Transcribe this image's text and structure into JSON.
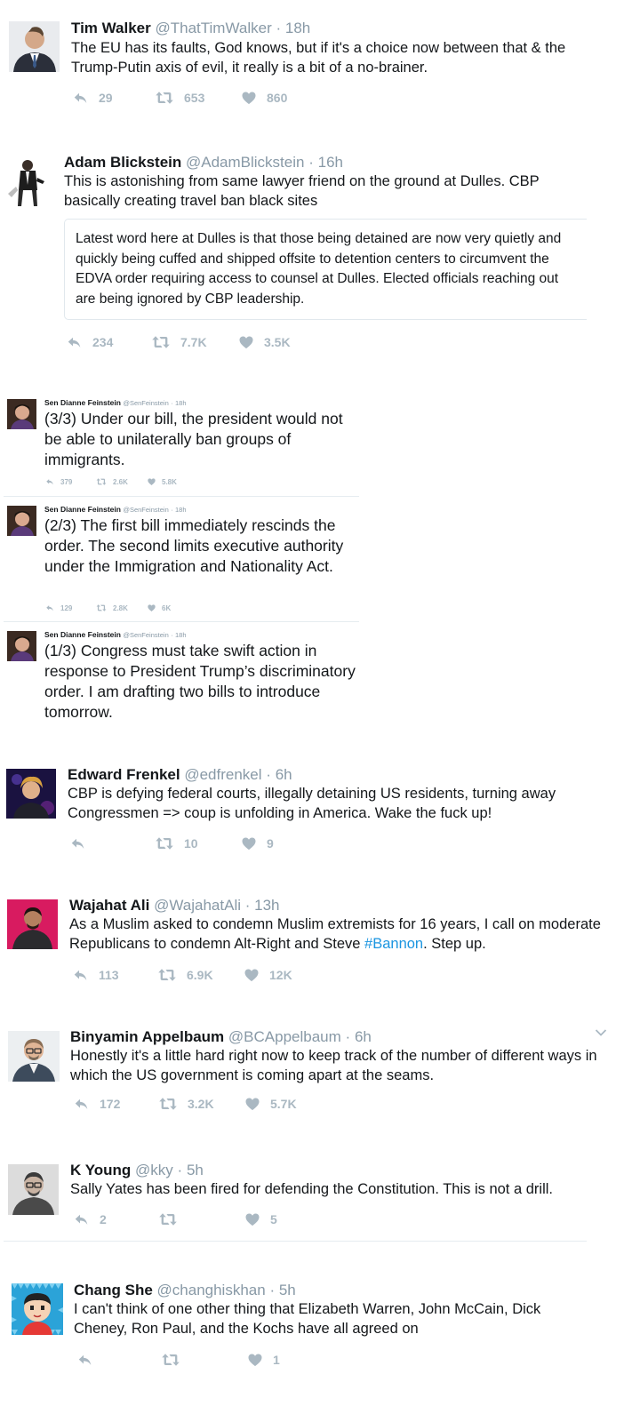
{
  "tweets": [
    {
      "name": "Tim Walker",
      "handle": "@ThatTimWalker",
      "time": "18h",
      "text": "The EU has its faults, God knows, but if it's a choice now between that & the Trump-Putin axis of evil, it really is a bit of a no-brainer.",
      "replies": "29",
      "retweets": "653",
      "likes": "860"
    },
    {
      "name": "Adam Blickstein",
      "handle": "@AdamBlickstein",
      "time": "16h",
      "text": "This is astonishing from same lawyer friend on the ground at Dulles. CBP basically creating travel ban black sites",
      "quote": "Latest word here at Dulles is that those being detained are now very quietly and quickly being cuffed and shipped offsite to detention centers to circumvent the EDVA order requiring access to counsel at Dulles. Elected officials reaching out are being ignored by CBP leadership.",
      "replies": "234",
      "retweets": "7.7K",
      "likes": "3.5K"
    },
    {
      "name": "Sen Dianne Feinstein",
      "handle": "@SenFeinstein",
      "time": "18h",
      "text": "(3/3) Under our bill, the president would not be able to unilaterally ban groups of immigrants.",
      "replies": "379",
      "retweets": "2.6K",
      "likes": "5.8K"
    },
    {
      "name": "Sen Dianne Feinstein",
      "handle": "@SenFeinstein",
      "time": "18h",
      "text": "(2/3) The first bill immediately rescinds the order. The second limits executive authority under the Immigration and Nationality Act.",
      "replies": "129",
      "retweets": "2.8K",
      "likes": "6K"
    },
    {
      "name": "Sen Dianne Feinstein",
      "handle": "@SenFeinstein",
      "time": "18h",
      "text": "(1/3) Congress must take swift action in response to President Trump’s discriminatory order. I am drafting two bills to introduce tomorrow."
    },
    {
      "name": "Edward Frenkel",
      "handle": "@edfrenkel",
      "time": "6h",
      "text": "CBP is defying federal courts, illegally detaining US residents, turning away Congressmen => coup is unfolding in America. Wake the fuck up!",
      "retweets": "10",
      "likes": "9"
    },
    {
      "name": "Wajahat Ali",
      "handle": "@WajahatAli",
      "time": "13h",
      "text_before": "As a Muslim asked to condemn Muslim extremists for 16 years, I call on moderate Republicans to condemn Alt-Right and Steve ",
      "hashtag": "#Bannon",
      "text_after": ". Step up.",
      "replies": "113",
      "retweets": "6.9K",
      "likes": "12K"
    },
    {
      "name": "Binyamin Appelbaum",
      "handle": "@BCAppelbaum",
      "time": "6h",
      "text": "Honestly it's a little hard right now to keep track of the number of different ways in which the US government is coming apart at the seams.",
      "replies": "172",
      "retweets": "3.2K",
      "likes": "5.7K"
    },
    {
      "name": "K Young",
      "handle": "@kky",
      "time": "5h",
      "text": "Sally Yates has been fired for defending the Constitution. This is not a drill.",
      "replies": "2",
      "likes": "5"
    },
    {
      "name": "Chang She",
      "handle": "@changhiskhan",
      "time": "5h",
      "text": "I can't think of one other thing that Elizabeth Warren, John McCain, Dick Cheney, Ron Paul, and the Kochs have all agreed on",
      "likes": "1"
    }
  ],
  "separator": "·",
  "icons": {
    "reply": "reply-icon",
    "retweet": "retweet-icon",
    "like": "heart-icon",
    "menu": "chevron-down-icon"
  },
  "colors": {
    "link": "#1b95e0",
    "muted": "#8899a6",
    "action": "#aab8c2"
  }
}
